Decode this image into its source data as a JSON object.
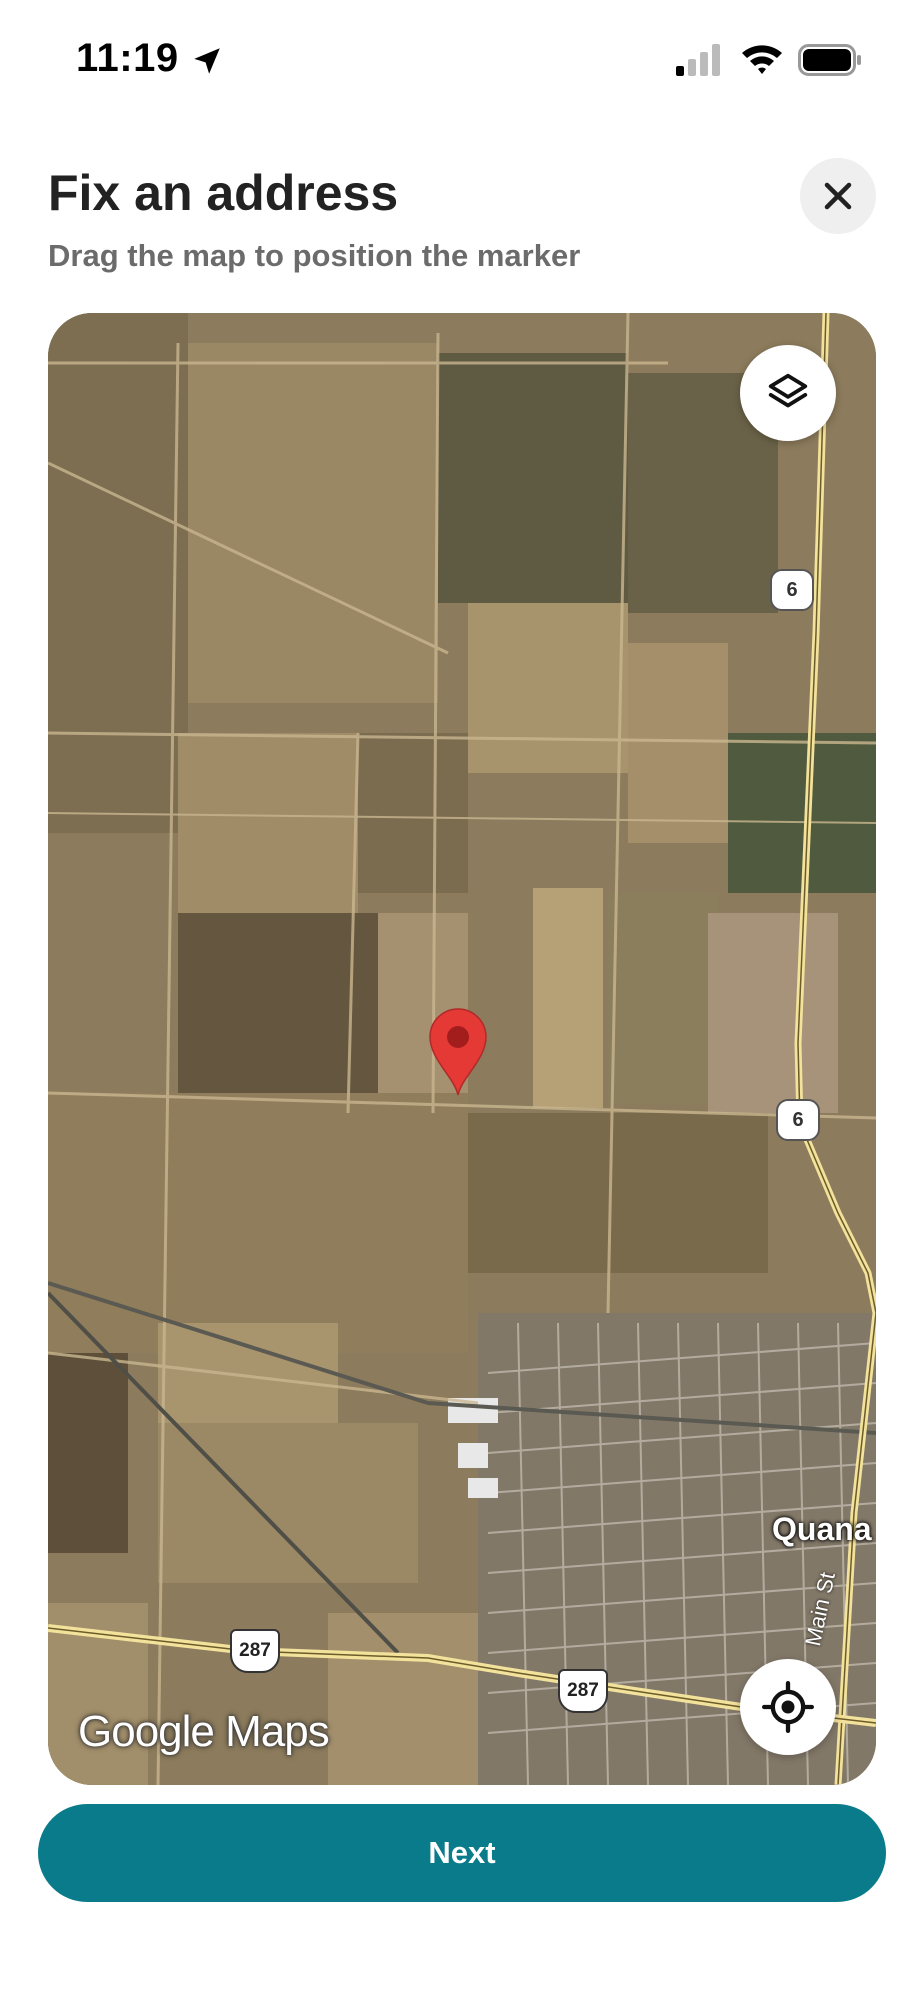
{
  "status_bar": {
    "time": "11:19",
    "icons": [
      "location-arrow-icon",
      "cellular-signal-icon",
      "wifi-icon",
      "battery-icon"
    ]
  },
  "header": {
    "title": "Fix an address",
    "subtitle": "Drag the map to position the marker",
    "close_icon": "close-icon"
  },
  "map": {
    "type": "satellite",
    "controls": [
      "layers-icon",
      "my-location-icon"
    ],
    "route_shields": [
      "6",
      "6",
      "287",
      "287"
    ],
    "city_label": "Quana",
    "street_label": "Main St",
    "attribution": "Google Maps",
    "marker_color": "#e53935"
  },
  "footer": {
    "next_label": "Next"
  },
  "colors": {
    "accent": "#0a7b8a",
    "title_text": "#222222",
    "subtitle_text": "#6b6b6b"
  }
}
